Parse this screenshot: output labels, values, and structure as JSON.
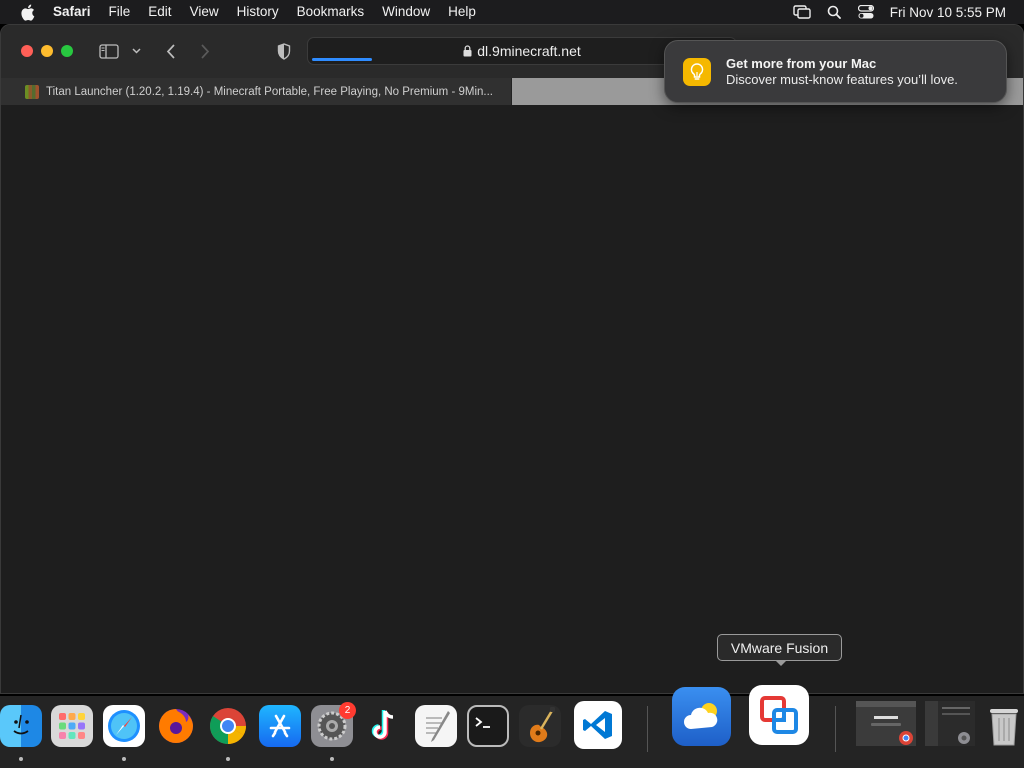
{
  "menubar": {
    "app_name": "Safari",
    "items": [
      "File",
      "Edit",
      "View",
      "History",
      "Bookmarks",
      "Window",
      "Help"
    ],
    "clock": "Fri Nov 10  5:55 PM",
    "right_icons": [
      "screen-mirroring-icon",
      "spotlight-search-icon",
      "control-center-icon"
    ]
  },
  "browser": {
    "url": "dl.9minecraft.net",
    "tab_title": "Titan Launcher (1.20.2, 1.19.4) - Minecraft Portable, Free Playing, No Premium - 9Min..."
  },
  "notification": {
    "title": "Get more from your Mac",
    "body": "Discover must-know features you’ll love.",
    "icon": "lightbulb-icon",
    "accent": "#f5b800"
  },
  "dock": {
    "tooltip": "VMware Fusion",
    "settings_badge": "2",
    "apps": [
      "Finder",
      "Launchpad",
      "Safari",
      "Firefox",
      "Google Chrome",
      "App Store",
      "System Settings",
      "TikTok",
      "TextEdit",
      "Terminal",
      "GarageBand",
      "Visual Studio Code",
      "Weather",
      "VMware Fusion",
      "Trash"
    ]
  },
  "colors": {
    "traffic_red": "#ff5f57",
    "traffic_yellow": "#febc2e",
    "traffic_green": "#28c840",
    "load_progress": "#2f8cff"
  }
}
